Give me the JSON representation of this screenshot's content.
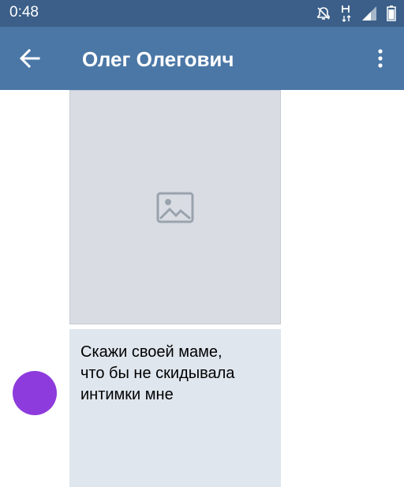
{
  "status_bar": {
    "time": "0:48",
    "icons": [
      "mute-icon",
      "data-h-icon",
      "signal-icon",
      "battery-icon"
    ]
  },
  "header": {
    "title": "Олег Олегович",
    "back_icon": "back-arrow-icon",
    "menu_icon": "more-vertical-icon"
  },
  "messages": [
    {
      "type": "photo"
    },
    {
      "type": "text",
      "text": "Скажи своей маме,\nчто бы не скидывала\nинтимки мне"
    }
  ],
  "colors": {
    "status_bar": "#3b5f88",
    "header": "#4b77a6",
    "bubble": "#dfe6ee",
    "avatar": "#8d3bdc"
  }
}
